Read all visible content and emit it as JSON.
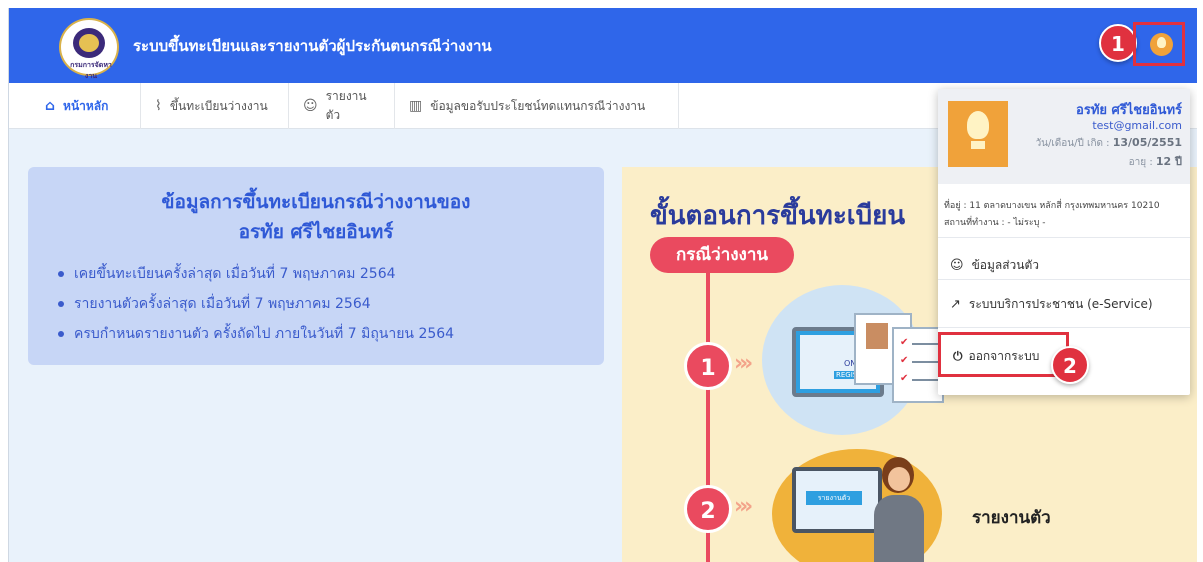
{
  "app": {
    "title": "ระบบขึ้นทะเบียนและรายงานตัวผู้ประกันตนกรณีว่างงาน",
    "logo_text": "กรมการจัดหางาน"
  },
  "callouts": {
    "one": "1",
    "two": "2"
  },
  "nav": {
    "home": "หน้าหลัก",
    "register": "ขึ้นทะเบียนว่างงาน",
    "report": "รายงานตัว",
    "benefits": "ข้อมูลขอรับประโยชน์ทดแทนกรณีว่างงาน"
  },
  "card": {
    "title": "ข้อมูลการขึ้นทะเบียนกรณีว่างงานของ",
    "name": "อรทัย ศรีไชยอินทร์",
    "bullets": [
      "เคยขึ้นทะเบียนครั้งล่าสุด เมื่อวันที่ 7 พฤษภาคม 2564",
      "รายงานตัวครั้งล่าสุด เมื่อวันที่ 7 พฤษภาคม 2564",
      "ครบกำหนดรายงานตัว ครั้งถัดไป ภายในวันที่ 7 มิถุนายน 2564"
    ]
  },
  "poster": {
    "title": "ขั้นตอนการขึ้นทะเบียน",
    "pill": "กรณีว่างงาน",
    "step1": "1",
    "step2": "2",
    "chevrons": "»",
    "screen_label": "รายงานตัว",
    "step2_label": "รายงานตัว",
    "monitor_text1": "ONI",
    "monitor_text2": "REGIST"
  },
  "user_menu": {
    "name": "อรทัย ศรีไชยอินทร์",
    "email": "test@gmail.com",
    "dob_label": "วัน/เดือน/ปี เกิด :",
    "dob": "13/05/2551",
    "age_label": "อายุ :",
    "age": "12 ปี",
    "address": "ที่อยู่ : 11 ตลาดบางเขน หลักสี่ กรุงเทพมหานคร 10210",
    "workplace": "สถานที่ทำงาน : - ไม่ระบุ -",
    "profile": "ข้อมูลส่วนตัว",
    "eservice": "ระบบบริการประชาชน (e-Service)",
    "logout": "ออกจากระบบ"
  },
  "colors": {
    "primary": "#2f66ea",
    "accent_red": "#e0313f",
    "card_bg": "#c7d6f6",
    "page_bg": "#e9f2fb"
  },
  "icons": {
    "home": "home-icon",
    "pulse": "pulse-icon",
    "user": "user-icon",
    "book": "book-icon",
    "share": "external-link-icon",
    "power": "power-icon"
  }
}
